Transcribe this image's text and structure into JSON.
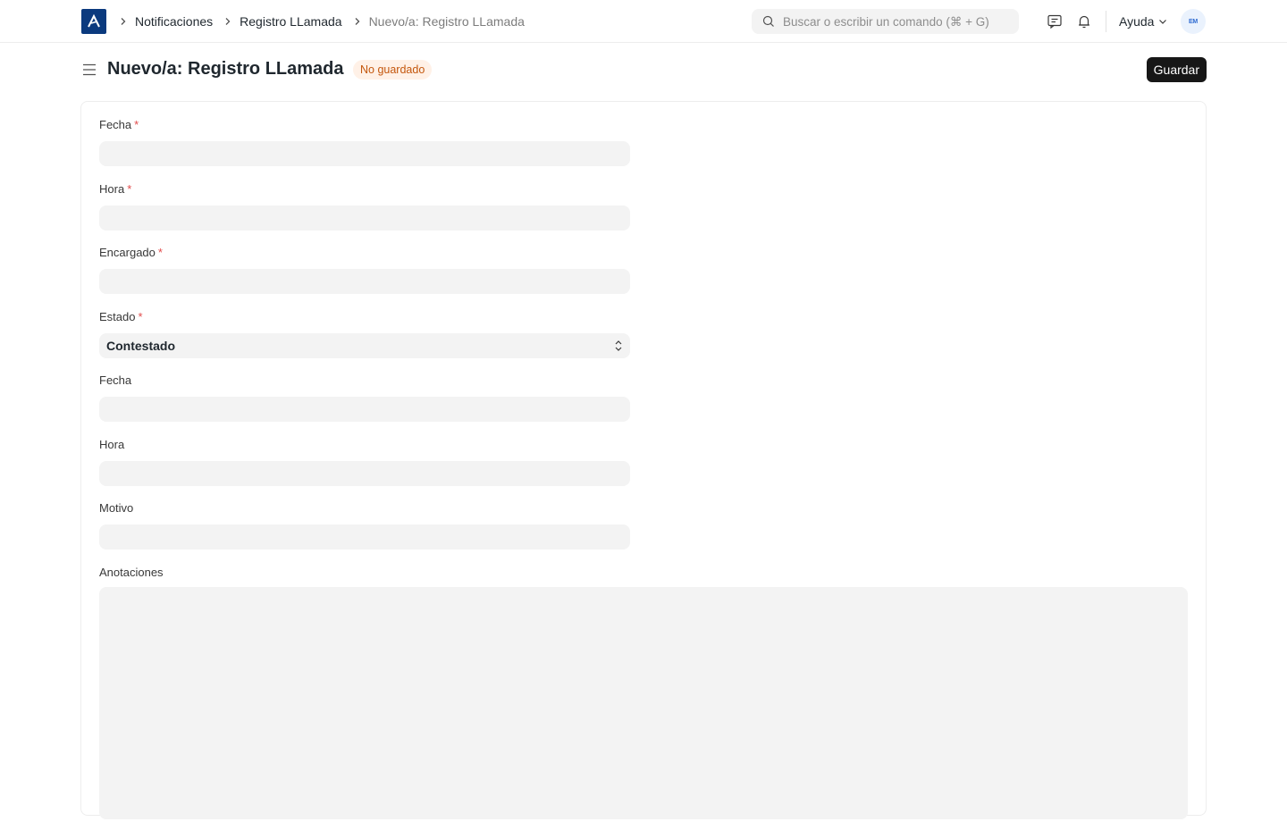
{
  "navbar": {
    "logo_icon": "app-logo-icon",
    "breadcrumbs": [
      "Notificaciones",
      "Registro LLamada",
      "Nuevo/a: Registro LLamada"
    ],
    "search_placeholder": "Buscar o escribir un comando (⌘ + G)",
    "help_label": "Ayuda",
    "avatar_initials": "EM"
  },
  "page": {
    "title": "Nuevo/a: Registro LLamada",
    "status": "No guardado",
    "save_label": "Guardar"
  },
  "form": {
    "fields": [
      {
        "label": "Fecha",
        "required": "*",
        "value": ""
      },
      {
        "label": "Hora",
        "required": "*",
        "value": ""
      },
      {
        "label": "Encargado",
        "required": "*",
        "value": ""
      },
      {
        "label": "Estado",
        "required": "*",
        "value": "Contestado"
      },
      {
        "label": "Fecha",
        "value": ""
      },
      {
        "label": "Hora",
        "value": ""
      },
      {
        "label": "Motivo",
        "value": ""
      },
      {
        "label": "Anotaciones",
        "value": ""
      }
    ]
  },
  "colors": {
    "accent": "#171717",
    "badge_bg": "#fff1e7",
    "badge_text": "#c4570d",
    "required": "#e24c4c",
    "logo": "#0b3a7e"
  }
}
